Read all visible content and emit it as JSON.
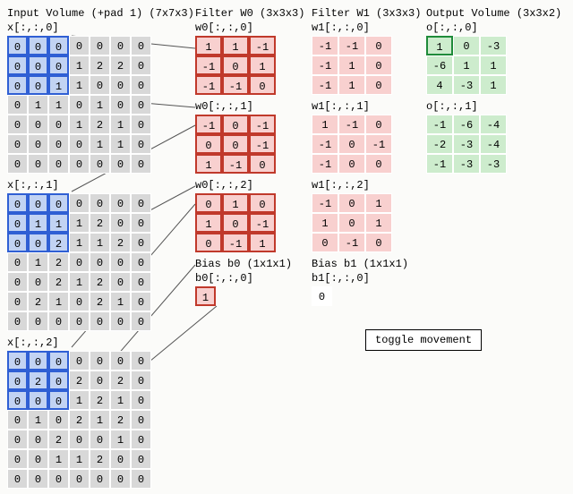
{
  "headers": {
    "input": "Input Volume (+pad 1) (7x7x3)",
    "w0": "Filter W0 (3x3x3)",
    "w1": "Filter W1 (3x3x3)",
    "out": "Output Volume (3x3x2)"
  },
  "input": {
    "slices": [
      {
        "label": "x[:,:,0]",
        "grid": [
          [
            0,
            0,
            0,
            0,
            0,
            0,
            0
          ],
          [
            0,
            0,
            0,
            1,
            2,
            2,
            0
          ],
          [
            0,
            0,
            1,
            1,
            0,
            0,
            0
          ],
          [
            0,
            1,
            1,
            0,
            1,
            0,
            0
          ],
          [
            0,
            0,
            0,
            1,
            2,
            1,
            0
          ],
          [
            0,
            0,
            0,
            0,
            1,
            1,
            0
          ],
          [
            0,
            0,
            0,
            0,
            0,
            0,
            0
          ]
        ]
      },
      {
        "label": "x[:,:,1]",
        "grid": [
          [
            0,
            0,
            0,
            0,
            0,
            0,
            0
          ],
          [
            0,
            1,
            1,
            1,
            2,
            0,
            0
          ],
          [
            0,
            0,
            2,
            1,
            1,
            2,
            0
          ],
          [
            0,
            1,
            2,
            0,
            0,
            0,
            0
          ],
          [
            0,
            0,
            2,
            1,
            2,
            0,
            0
          ],
          [
            0,
            2,
            1,
            0,
            2,
            1,
            0
          ],
          [
            0,
            0,
            0,
            0,
            0,
            0,
            0
          ]
        ]
      },
      {
        "label": "x[:,:,2]",
        "grid": [
          [
            0,
            0,
            0,
            0,
            0,
            0,
            0
          ],
          [
            0,
            2,
            0,
            2,
            0,
            2,
            0
          ],
          [
            0,
            0,
            0,
            1,
            2,
            1,
            0
          ],
          [
            0,
            1,
            0,
            2,
            1,
            2,
            0
          ],
          [
            0,
            0,
            2,
            0,
            0,
            1,
            0
          ],
          [
            0,
            0,
            1,
            1,
            2,
            0,
            0
          ],
          [
            0,
            0,
            0,
            0,
            0,
            0,
            0
          ]
        ]
      }
    ],
    "highlight_rows": [
      0,
      1,
      2
    ],
    "highlight_cols": [
      0,
      1,
      2
    ]
  },
  "filters": {
    "w0": [
      {
        "label": "w0[:,:,0]",
        "grid": [
          [
            1,
            1,
            -1
          ],
          [
            -1,
            0,
            1
          ],
          [
            -1,
            -1,
            0
          ]
        ]
      },
      {
        "label": "w0[:,:,1]",
        "grid": [
          [
            -1,
            0,
            -1
          ],
          [
            0,
            0,
            -1
          ],
          [
            1,
            -1,
            0
          ]
        ]
      },
      {
        "label": "w0[:,:,2]",
        "grid": [
          [
            0,
            1,
            0
          ],
          [
            1,
            0,
            -1
          ],
          [
            0,
            -1,
            1
          ]
        ]
      }
    ],
    "w1": [
      {
        "label": "w1[:,:,0]",
        "grid": [
          [
            -1,
            -1,
            0
          ],
          [
            -1,
            1,
            0
          ],
          [
            -1,
            1,
            0
          ]
        ]
      },
      {
        "label": "w1[:,:,1]",
        "grid": [
          [
            1,
            -1,
            0
          ],
          [
            -1,
            0,
            -1
          ],
          [
            -1,
            0,
            0
          ]
        ]
      },
      {
        "label": "w1[:,:,2]",
        "grid": [
          [
            -1,
            0,
            1
          ],
          [
            1,
            0,
            1
          ],
          [
            0,
            -1,
            0
          ]
        ]
      }
    ]
  },
  "biases": {
    "b0": {
      "title": "Bias b0 (1x1x1)",
      "label": "b0[:,:,0]",
      "value": 1
    },
    "b1": {
      "title": "Bias b1 (1x1x1)",
      "label": "b1[:,:,0]",
      "value": 0
    }
  },
  "output": [
    {
      "label": "o[:,:,0]",
      "grid": [
        [
          1,
          0,
          -3
        ],
        [
          -6,
          1,
          1
        ],
        [
          4,
          -3,
          1
        ]
      ],
      "highlight": [
        0,
        0
      ]
    },
    {
      "label": "o[:,:,1]",
      "grid": [
        [
          -1,
          -6,
          -4
        ],
        [
          -2,
          -3,
          -4
        ],
        [
          -1,
          -3,
          -3
        ]
      ]
    }
  ],
  "toggle_label": "toggle movement",
  "chart_data": {
    "type": "table",
    "description": "Visualization of a 2D convolution step: 7x7x3 padded input, two 3x3x3 filters W0 and W1 with biases b0=1 and b1=0, producing a 3x3x2 output. The 3x3 receptive field at top-left of each input slice (blue) dot-products with the corresponding W0 slice (red) and sums with b0 to yield output[0,0,0]=1 (green).",
    "input_shape": [
      7,
      7,
      3
    ],
    "filter_shape": [
      3,
      3,
      3
    ],
    "num_filters": 2,
    "output_shape": [
      3,
      3,
      2
    ],
    "input": [
      [
        [
          0,
          0,
          0,
          0,
          0,
          0,
          0
        ],
        [
          0,
          0,
          0,
          1,
          2,
          2,
          0
        ],
        [
          0,
          0,
          1,
          1,
          0,
          0,
          0
        ],
        [
          0,
          1,
          1,
          0,
          1,
          0,
          0
        ],
        [
          0,
          0,
          0,
          1,
          2,
          1,
          0
        ],
        [
          0,
          0,
          0,
          0,
          1,
          1,
          0
        ],
        [
          0,
          0,
          0,
          0,
          0,
          0,
          0
        ]
      ],
      [
        [
          0,
          0,
          0,
          0,
          0,
          0,
          0
        ],
        [
          0,
          1,
          1,
          1,
          2,
          0,
          0
        ],
        [
          0,
          0,
          2,
          1,
          1,
          2,
          0
        ],
        [
          0,
          1,
          2,
          0,
          0,
          0,
          0
        ],
        [
          0,
          0,
          2,
          1,
          2,
          0,
          0
        ],
        [
          0,
          2,
          1,
          0,
          2,
          1,
          0
        ],
        [
          0,
          0,
          0,
          0,
          0,
          0,
          0
        ]
      ],
      [
        [
          0,
          0,
          0,
          0,
          0,
          0,
          0
        ],
        [
          0,
          2,
          0,
          2,
          0,
          2,
          0
        ],
        [
          0,
          0,
          0,
          1,
          2,
          1,
          0
        ],
        [
          0,
          1,
          0,
          2,
          1,
          2,
          0
        ],
        [
          0,
          0,
          2,
          0,
          0,
          1,
          0
        ],
        [
          0,
          0,
          1,
          1,
          2,
          0,
          0
        ],
        [
          0,
          0,
          0,
          0,
          0,
          0,
          0
        ]
      ]
    ],
    "W0": [
      [
        [
          1,
          1,
          -1
        ],
        [
          -1,
          0,
          1
        ],
        [
          -1,
          -1,
          0
        ]
      ],
      [
        [
          -1,
          0,
          -1
        ],
        [
          0,
          0,
          -1
        ],
        [
          1,
          -1,
          0
        ]
      ],
      [
        [
          0,
          1,
          0
        ],
        [
          1,
          0,
          -1
        ],
        [
          0,
          -1,
          1
        ]
      ]
    ],
    "W1": [
      [
        [
          -1,
          -1,
          0
        ],
        [
          -1,
          1,
          0
        ],
        [
          -1,
          1,
          0
        ]
      ],
      [
        [
          1,
          -1,
          0
        ],
        [
          -1,
          0,
          -1
        ],
        [
          -1,
          0,
          0
        ]
      ],
      [
        [
          -1,
          0,
          1
        ],
        [
          1,
          0,
          1
        ],
        [
          0,
          -1,
          0
        ]
      ]
    ],
    "b0": 1,
    "b1": 0,
    "output": [
      [
        [
          1,
          0,
          -3
        ],
        [
          -6,
          1,
          1
        ],
        [
          4,
          -3,
          1
        ]
      ],
      [
        [
          -1,
          -6,
          -4
        ],
        [
          -2,
          -3,
          -4
        ],
        [
          -1,
          -3,
          -3
        ]
      ]
    ]
  }
}
